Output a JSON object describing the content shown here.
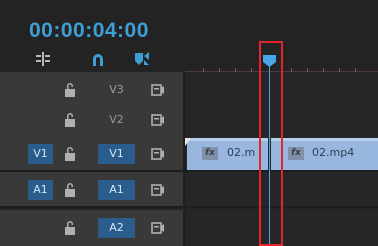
{
  "timecode": "00:00:04:00",
  "tools": [
    {
      "icon": "snap-insert-icon"
    },
    {
      "icon": "linked-selection-magnet-icon"
    },
    {
      "icon": "add-marker-icon"
    }
  ],
  "tracks": [
    {
      "source_label": "",
      "target_label": "V3",
      "target_active": false,
      "lock_icon": "lock-icon",
      "toggle_icon": "track-output-icon"
    },
    {
      "source_label": "",
      "target_label": "V2",
      "target_active": false,
      "lock_icon": "lock-icon",
      "toggle_icon": "track-output-icon"
    },
    {
      "source_label": "V1",
      "target_label": "V1",
      "target_active": true,
      "lock_icon": "lock-icon",
      "toggle_icon": "track-output-icon"
    },
    {
      "source_label": "A1",
      "target_label": "A1",
      "target_active": true,
      "lock_icon": "lock-icon",
      "toggle_icon": "track-output-icon"
    },
    {
      "source_label": "",
      "target_label": "A2",
      "target_active": true,
      "lock_icon": "lock-icon",
      "toggle_icon": "track-output-icon"
    }
  ],
  "clips": [
    {
      "fx": "fx",
      "name": "02.m"
    },
    {
      "fx": "fx",
      "name": "02.mp4"
    }
  ],
  "colors": {
    "accent": "#3e9ed6",
    "track_target": "#2a5d8c",
    "clip": "#99b7de",
    "highlight": "#e1262e",
    "playhead": "#4aa5e8"
  }
}
